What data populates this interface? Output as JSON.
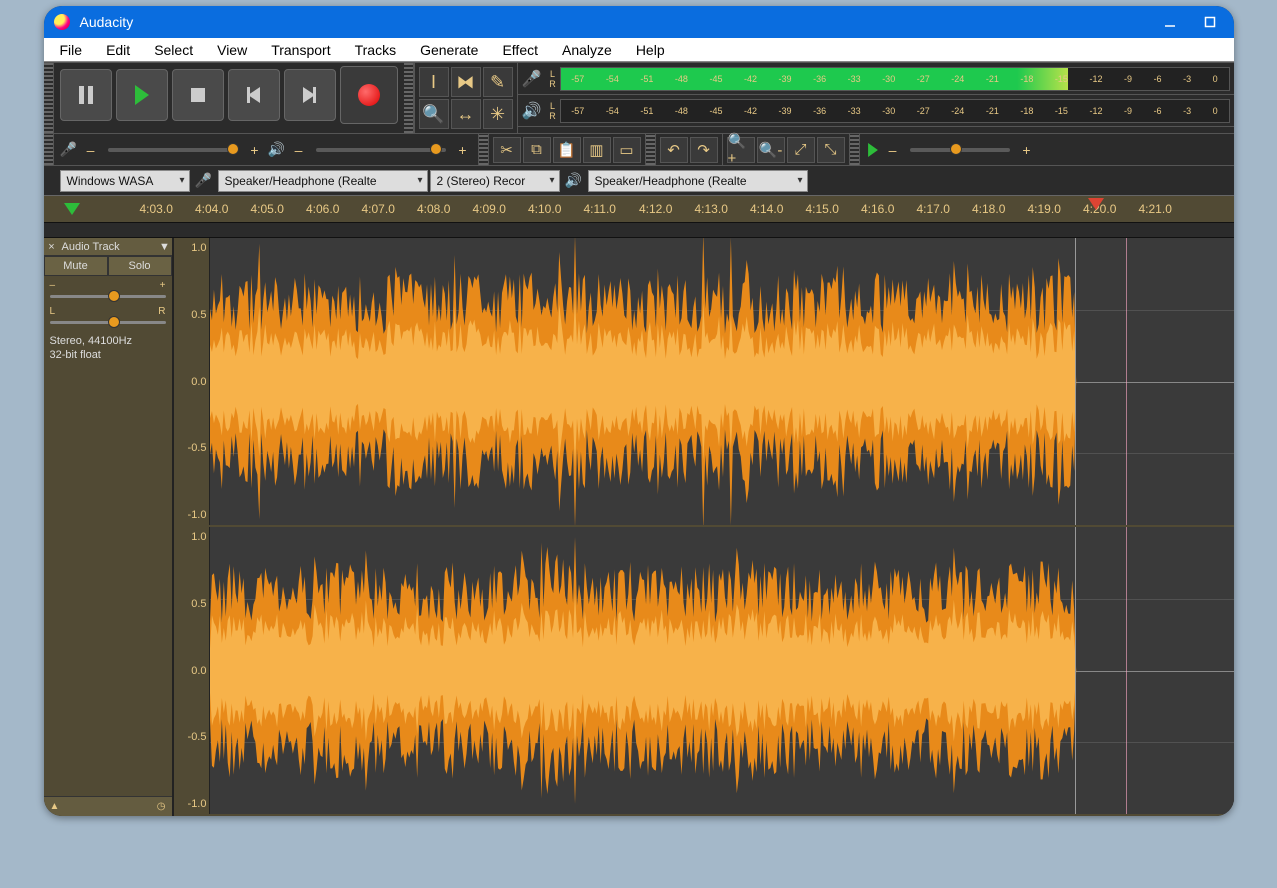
{
  "title": "Audacity",
  "menu": [
    "File",
    "Edit",
    "Select",
    "View",
    "Transport",
    "Tracks",
    "Generate",
    "Effect",
    "Analyze",
    "Help"
  ],
  "transport": {
    "pause": "pause-button",
    "play": "play-button",
    "stop": "stop-button",
    "skipstart": "skip-start-button",
    "skipend": "skip-end-button",
    "record": "record-button"
  },
  "tools": [
    "selection-tool",
    "envelope-tool",
    "draw-tool",
    "zoom-tool",
    "timeshift-tool",
    "multi-tool"
  ],
  "meter_ticks": [
    "-57",
    "-54",
    "-51",
    "-48",
    "-45",
    "-42",
    "-39",
    "-36",
    "-33",
    "-30",
    "-27",
    "-24",
    "-21",
    "-18",
    "-15",
    "-12",
    "-9",
    "-6",
    "-3",
    "0"
  ],
  "meter_lr": {
    "l": "L",
    "r": "R"
  },
  "recording_meter_fill_pct": 76,
  "sliders": {
    "rec_minus": "–",
    "rec_plus": "+",
    "play_minus": "–",
    "play_plus": "+",
    "rec_thumb_pct": 92,
    "play_thumb_pct": 88
  },
  "edit_tools": [
    "cut",
    "copy",
    "paste",
    "trim",
    "silence",
    "undo",
    "redo",
    "zoom-in",
    "zoom-out",
    "fit-selection",
    "fit-project"
  ],
  "play_at_speed": {
    "thumb_pct": 40
  },
  "devices": {
    "host": "Windows WASA",
    "rec_device": "Speaker/Headphone (Realte",
    "rec_channels": "2 (Stereo) Recor",
    "play_device": "Speaker/Headphone (Realte"
  },
  "ruler": {
    "labels": [
      "4:03.0",
      "4:04.0",
      "4:05.0",
      "4:06.0",
      "4:07.0",
      "4:08.0",
      "4:09.0",
      "4:10.0",
      "4:11.0",
      "4:12.0",
      "4:13.0",
      "4:14.0",
      "4:15.0",
      "4:16.0",
      "4:17.0",
      "4:18.0",
      "4:19.0",
      "4:20.0",
      "4:21.0"
    ],
    "playhead_label_start": "4:03.0",
    "playhead_label_cur": "4:19.0"
  },
  "track": {
    "name": "Audio Track",
    "mute": "Mute",
    "solo": "Solo",
    "gain_minus": "–",
    "gain_plus": "+",
    "pan_l": "L",
    "pan_r": "R",
    "gain_thumb_pct": 50,
    "pan_thumb_pct": 50,
    "info1": "Stereo, 44100Hz",
    "info2": "32-bit float",
    "collapse": "▲",
    "menu": "◷"
  },
  "scale": {
    "p10": "1.0",
    "p05": "0.5",
    "z": "0.0",
    "m05": "-0.5",
    "m10": "-1.0"
  },
  "colors": {
    "wave_light": "#f7b24a",
    "wave_dark": "#e88a1a",
    "accent_green": "#2dbd3a"
  }
}
